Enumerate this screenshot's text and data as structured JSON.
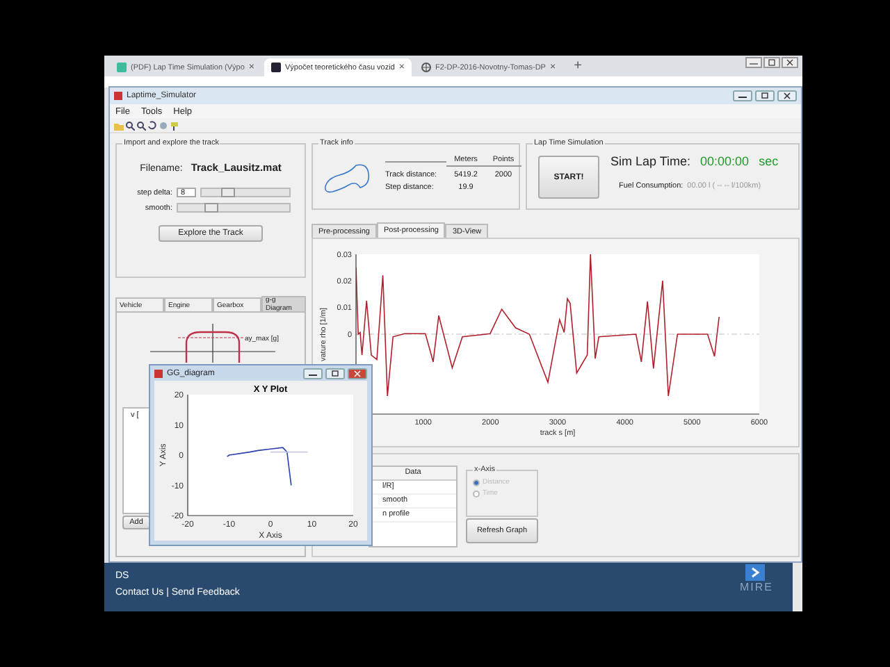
{
  "browser": {
    "tabs": [
      {
        "label": "(PDF) Lap Time Simulation (Výpo",
        "selected": false
      },
      {
        "label": "Výpočet teoretického času vozid",
        "selected": true
      },
      {
        "label": "F2-DP-2016-Novotny-Tomas-DP",
        "selected": false
      }
    ],
    "close": "×",
    "new_tab": "+"
  },
  "app": {
    "title": "Laptime_Simulator",
    "menu": [
      "File",
      "Tools",
      "Help"
    ],
    "import_panel": {
      "title": "Import and explore the track",
      "filename_label": "Filename:",
      "filename": "Track_Lausitz.mat",
      "step_delta_label": "step delta:",
      "step_delta": "8",
      "step_slider": {
        "level": 0.3
      },
      "smooth_label": "smooth:",
      "smooth_slider": {
        "level": 0.3
      },
      "button": "Explore the Track"
    },
    "vehicle_tabs": [
      {
        "label": "Vehicle",
        "selected": false
      },
      {
        "label": "Engine",
        "selected": false
      },
      {
        "label": "Gearbox",
        "selected": false
      },
      {
        "label": "g-g Diagram",
        "selected": true
      }
    ],
    "gg_panel": {
      "axis_label": "ay_max [g]",
      "table_header": "v [",
      "add_button": "Add"
    },
    "track_info": {
      "title": "Track info",
      "columns": [
        "Meters",
        "Points"
      ],
      "rows": [
        {
          "label": "Track distance:",
          "meters": "5419.2",
          "points": "2000"
        },
        {
          "label": "Step distance:",
          "meters": "19.9"
        }
      ]
    },
    "lap_sim": {
      "title": "Lap Time Simulation",
      "button": "START!",
      "time_label": "Sim Lap Time:",
      "time": "00:00:00",
      "time_unit": "sec",
      "fuel_label": "Fuel Consumption:",
      "fuel_value": "00.00 l ( -- -- l/100km)"
    },
    "view_tabs": [
      {
        "label": "Pre-processing",
        "selected": false
      },
      {
        "label": "Post-processing",
        "selected": true
      },
      {
        "label": "3D-View",
        "selected": false
      }
    ],
    "chart": {
      "ylabel_visible": "vature rho [1/m]",
      "chart_data": {
        "type": "line",
        "xlabel": "track s [m]",
        "xlim": [
          0,
          6000
        ],
        "ylim": [
          -0.03,
          0.03
        ],
        "xticks": [
          1000,
          2000,
          3000,
          4000,
          5000,
          6000
        ],
        "yticks": [
          0,
          0.01,
          0.02,
          0.03
        ],
        "x": [
          0,
          34,
          62,
          89,
          158,
          227,
          310,
          399,
          468,
          551,
          723,
          1032,
          1149,
          1232,
          1432,
          1583,
          1996,
          2168,
          2374,
          2581,
          2856,
          3028,
          3097,
          3145,
          3187,
          3283,
          3441,
          3489,
          3558,
          3613,
          4164,
          4246,
          4336,
          4425,
          4563,
          4646,
          4783,
          5230,
          5334,
          5403
        ],
        "series": [
          {
            "color": "#b0202c",
            "values": [
              0.025,
              0,
              0.0007,
              -0.0078,
              0.0126,
              -0.0078,
              -0.0095,
              0.0221,
              -0.0232,
              -0.001,
              0.0002,
              0.0002,
              -0.0104,
              0.007,
              -0.0126,
              -0.001,
              0.0002,
              0.0094,
              0.0024,
              0,
              -0.0181,
              0.0055,
              0.0007,
              0.0133,
              0.0116,
              -0.0146,
              -0.0078,
              0.03,
              -0.0092,
              -0.001,
              0,
              -0.0104,
              0.0123,
              -0.0129,
              0.0201,
              -0.0232,
              0,
              0,
              -0.0083,
              0.0065
            ]
          }
        ]
      }
    },
    "data_table": {
      "header": "Data",
      "rows": [
        "l/R]",
        "smooth",
        "n profile"
      ]
    },
    "x_axis_group": {
      "title": "x-Axis",
      "disabled": true,
      "options": [
        {
          "label": "Distance",
          "selected": true
        },
        {
          "label": "Time",
          "selected": false
        }
      ]
    },
    "refresh_button": "Refresh Graph"
  },
  "gg_window": {
    "title": "GG_diagram",
    "chart_data": {
      "type": "line",
      "title": "X Y Plot",
      "xlabel": "X Axis",
      "ylabel": "Y Axis",
      "xlim": [
        -20,
        20
      ],
      "ylim": [
        -20,
        20
      ],
      "xticks": [
        -20,
        -10,
        0,
        10,
        20
      ],
      "yticks": [
        -20,
        -10,
        0,
        10,
        20
      ],
      "x": [
        -10.5,
        -10,
        -5,
        -3,
        0,
        3,
        4,
        5,
        9
      ],
      "series": [
        {
          "color": "#2a3fb0",
          "values": [
            -0.5,
            0,
            1,
            1.5,
            2,
            2.5,
            1,
            -10,
            null
          ]
        },
        {
          "color": "#c8c8e0",
          "values": [
            null,
            null,
            null,
            null,
            1,
            1,
            1,
            1,
            1
          ]
        }
      ]
    }
  },
  "web_footer": {
    "partial_text": "DS",
    "links": "Contact Us | Send Feedback",
    "logo": "MIRE"
  }
}
